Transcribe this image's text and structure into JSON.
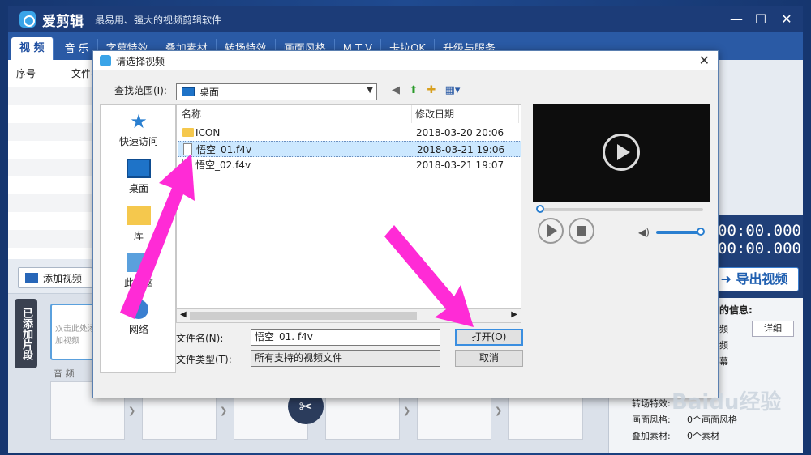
{
  "app": {
    "name": "爱剪辑",
    "slogan": "最易用、强大的视频剪辑软件"
  },
  "window_controls": {
    "minimize": "—",
    "maximize": "☐",
    "close": "✕"
  },
  "tabs": [
    {
      "label": "视 频",
      "active": true
    },
    {
      "label": "音 乐"
    },
    {
      "label": "字幕特效"
    },
    {
      "label": "叠加素材"
    },
    {
      "label": "转场特效"
    },
    {
      "label": "画面风格"
    },
    {
      "label": "M T V"
    },
    {
      "label": "卡拉OK"
    },
    {
      "label": "升级与服务"
    }
  ],
  "list": {
    "col_index": "序号",
    "col_file": "文件名"
  },
  "add_video": "添加视频",
  "clips": {
    "added_label": "已添加片段",
    "slot_text": "双击此处添加视频",
    "audio_label": "音 频"
  },
  "right": {
    "timecode_1": "00:00.000",
    "timecode_2": "00:00.000",
    "export": "导出视频",
    "info_title": "的信息:",
    "detail": "详细",
    "info_rows": [
      "频",
      "频",
      "幕"
    ],
    "style_label": "画面风格:",
    "style_value": "0个画面风格",
    "overlay_label": "叠加素材:",
    "overlay_value": "0个素材",
    "transition_label": "转场特效:"
  },
  "dialog": {
    "title": "请选择视频",
    "lookin_label": "查找范围(I):",
    "lookin_value": "桌面",
    "places": [
      "快速访问",
      "桌面",
      "库",
      "此电脑",
      "网络"
    ],
    "columns": {
      "name": "名称",
      "date": "修改日期"
    },
    "files": [
      {
        "name": "ICON",
        "date": "2018-03-20 20:06",
        "type": "folder"
      },
      {
        "name": "悟空_01.f4v",
        "date": "2018-03-21 19:06",
        "type": "file",
        "selected": true
      },
      {
        "name": "悟空_02.f4v",
        "date": "2018-03-21 19:07",
        "type": "file"
      }
    ],
    "filename_label": "文件名(N):",
    "filename_value": "悟空_01. f4v",
    "filetype_label": "文件类型(T):",
    "filetype_value": "所有支持的视频文件",
    "open_btn": "打开(O)",
    "cancel_btn": "取消"
  },
  "watermark": "Baidu经验",
  "colors": {
    "accent": "#2a5aa5",
    "arrow": "#ff2bd6",
    "title_bg": "#1c3c78"
  }
}
